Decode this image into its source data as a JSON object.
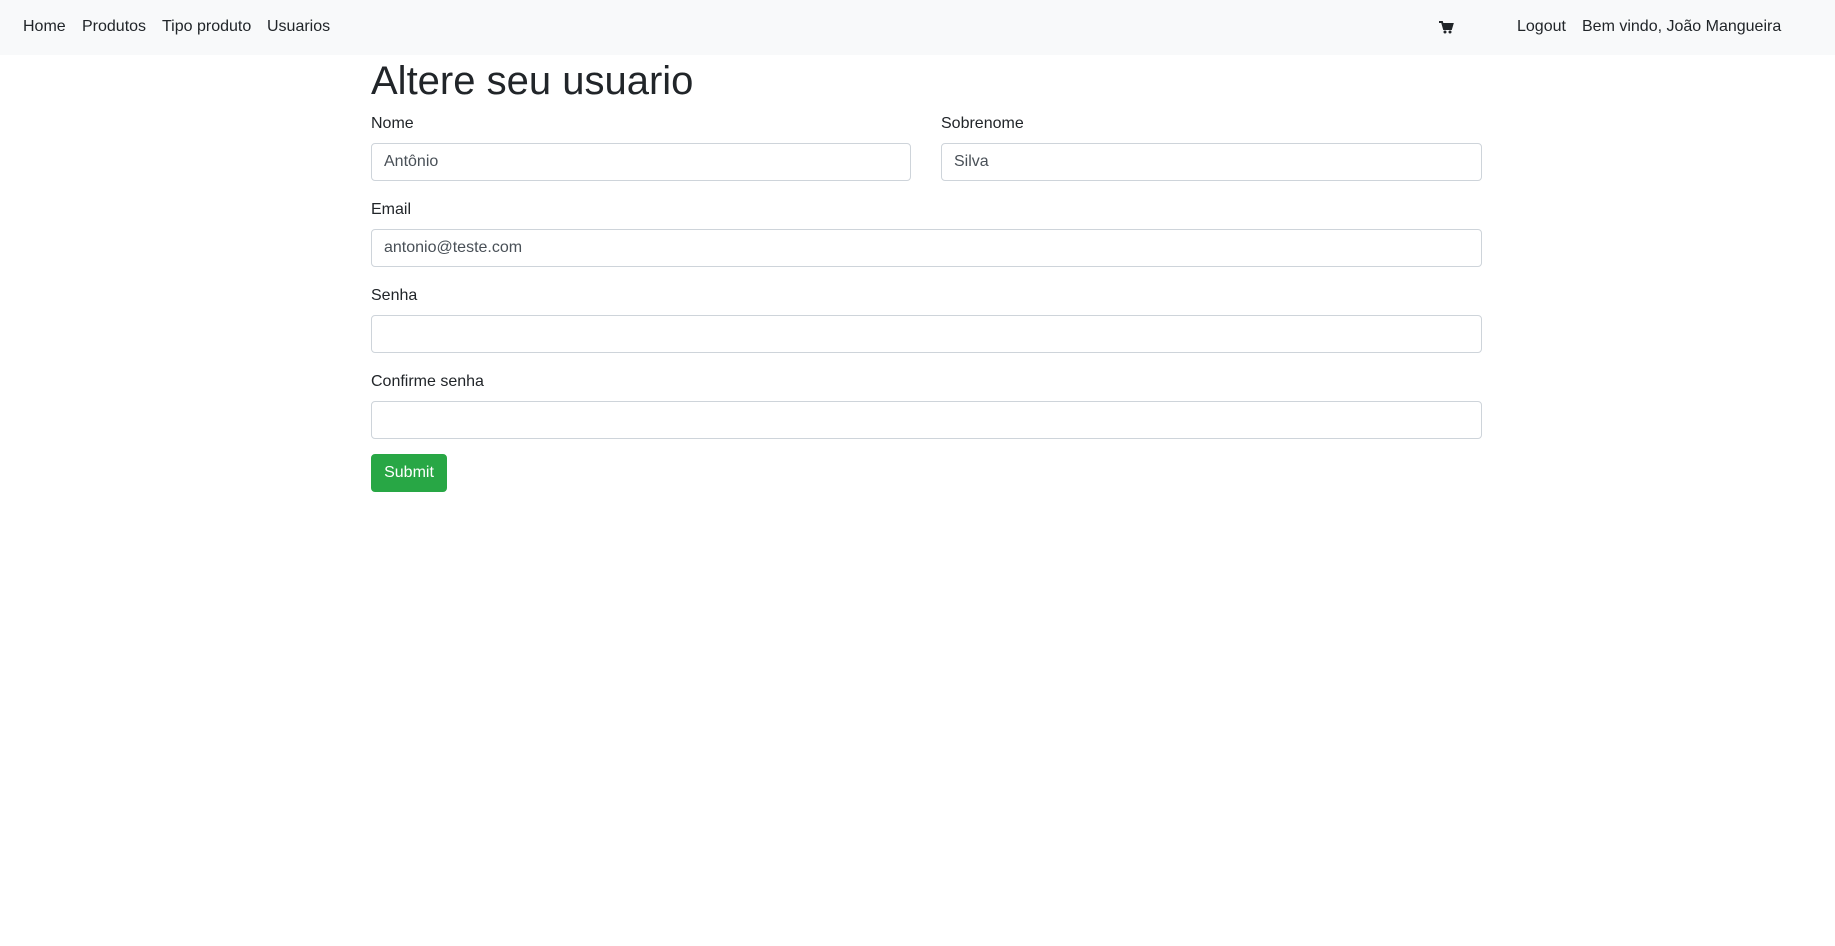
{
  "nav": {
    "links": [
      {
        "label": "Home"
      },
      {
        "label": "Produtos"
      },
      {
        "label": "Tipo produto"
      },
      {
        "label": "Usuarios"
      }
    ],
    "cart_icon": "cart-icon",
    "logout_label": "Logout",
    "welcome_text": "Bem vindo, João Mangueira"
  },
  "form": {
    "title": "Altere seu usuario",
    "nome": {
      "label": "Nome",
      "value": "Antônio"
    },
    "sobrenome": {
      "label": "Sobrenome",
      "value": "Silva"
    },
    "email": {
      "label": "Email",
      "value": "antonio@teste.com"
    },
    "senha": {
      "label": "Senha",
      "value": ""
    },
    "confirme": {
      "label": "Confirme senha",
      "value": ""
    },
    "submit_label": "Submit"
  },
  "colors": {
    "navbar_bg": "#f8f9fa",
    "submit_bg": "#28a745"
  }
}
